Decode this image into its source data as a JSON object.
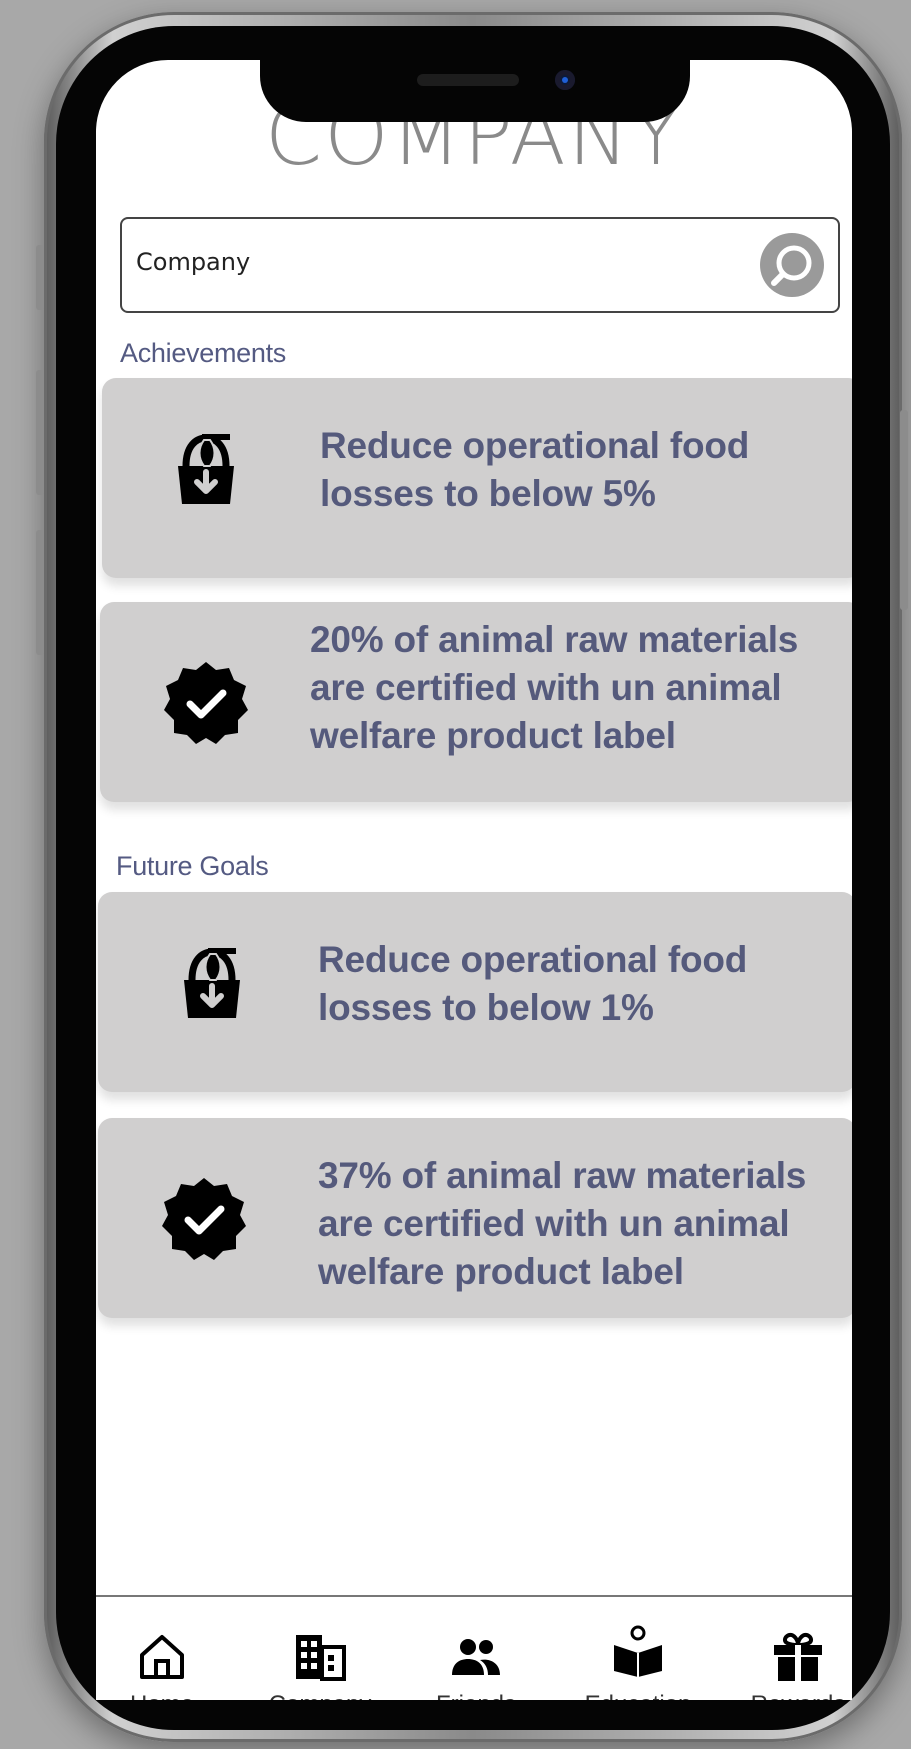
{
  "header": {
    "title": "COMPANY"
  },
  "search": {
    "value": "Company",
    "placeholder": ""
  },
  "sections": {
    "achievements": {
      "label": "Achievements",
      "cards": [
        {
          "icon": "basket-download-icon",
          "line1": "Reduce operational food",
          "line2": "losses to below 5%",
          "line3": ""
        },
        {
          "icon": "verified-badge-icon",
          "line1": "20% of animal raw materials",
          "line2": "are certified with un animal",
          "line3": "welfare product label"
        }
      ]
    },
    "future_goals": {
      "label": "Future Goals",
      "cards": [
        {
          "icon": "basket-download-icon",
          "line1": "Reduce operational food",
          "line2": "losses to below 1%",
          "line3": ""
        },
        {
          "icon": "verified-badge-icon",
          "line1": "37% of animal raw materials",
          "line2": "are certified with un animal",
          "line3": "welfare product label"
        }
      ]
    }
  },
  "nav": {
    "items": [
      {
        "label": "Home",
        "icon": "home-icon"
      },
      {
        "label": "Company",
        "icon": "building-icon"
      },
      {
        "label": "Friends",
        "icon": "people-icon"
      },
      {
        "label": "Education",
        "icon": "book-reader-icon"
      },
      {
        "label": "Rewards",
        "icon": "gift-icon"
      }
    ]
  },
  "colors": {
    "card_bg": "#d0cfcf",
    "card_text": "#555a7c",
    "section_label": "#545a82",
    "title": "#8a8a8a"
  }
}
